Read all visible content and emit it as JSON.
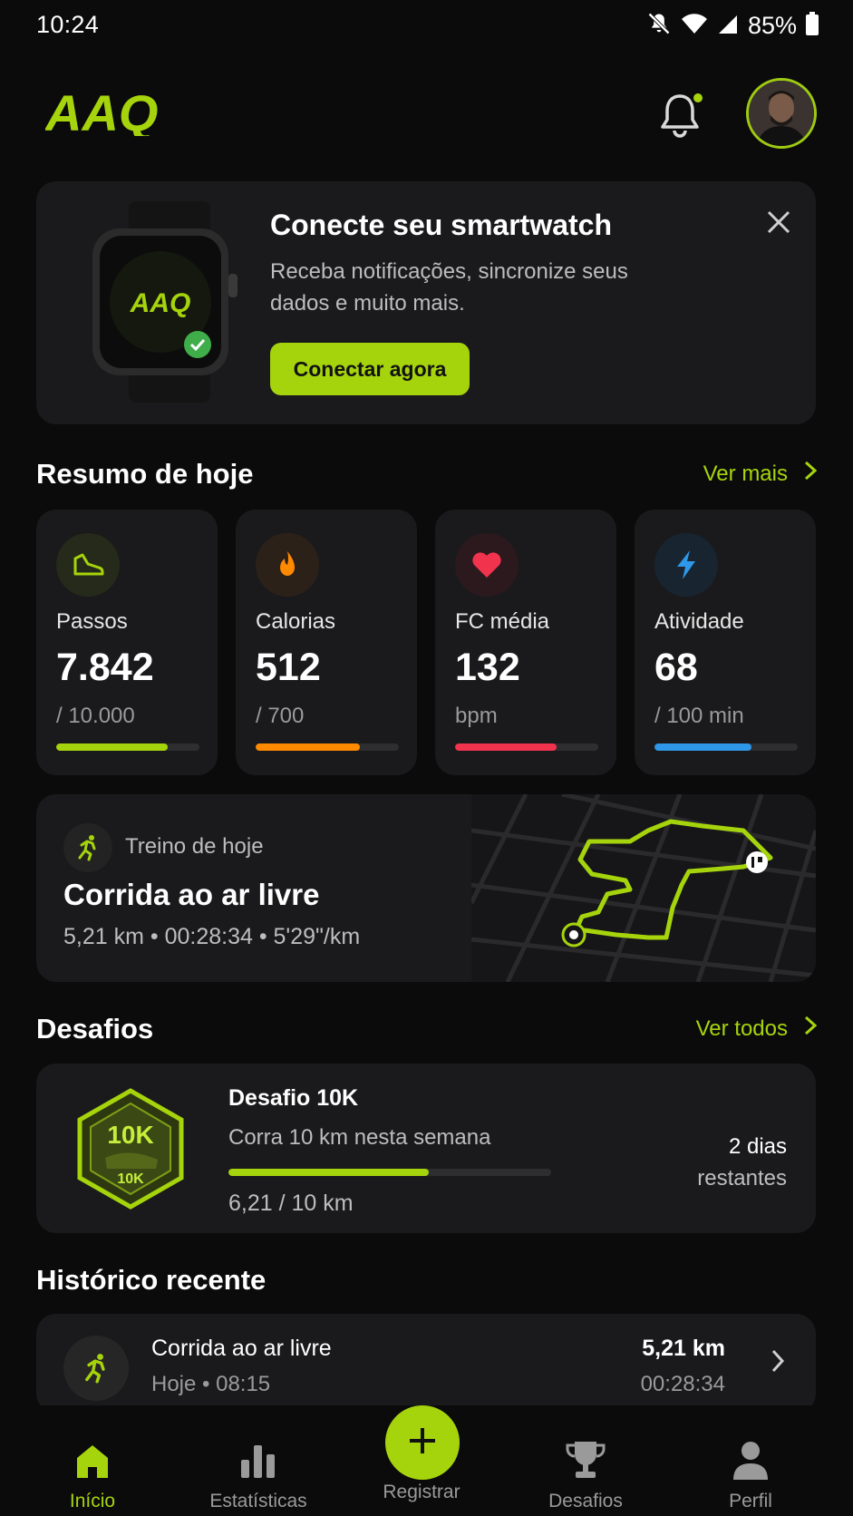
{
  "status_bar": {
    "time": "10:24",
    "battery_pct": "85%"
  },
  "header": {
    "logo_text": "AAQ"
  },
  "smartwatch_card": {
    "title": "Conecte seu smartwatch",
    "description": "Receba notificações, sincronize seus dados e muito mais.",
    "button_label": "Conectar agora",
    "watch_logo": "AAQ"
  },
  "today_summary": {
    "title": "Resumo de hoje",
    "link": "Ver mais",
    "metrics": [
      {
        "label": "Passos",
        "value": "7.842",
        "sub": "/ 10.000",
        "progress": 0.78,
        "color": "#a6d40c",
        "icon": "shoe-icon"
      },
      {
        "label": "Calorias",
        "value": "512",
        "sub": "/ 700",
        "progress": 0.73,
        "color": "#ff8a00",
        "icon": "flame-icon"
      },
      {
        "label": "FC média",
        "value": "132",
        "sub": "bpm",
        "progress": 0.71,
        "color": "#f2334d",
        "icon": "heart-icon"
      },
      {
        "label": "Atividade",
        "value": "68",
        "sub": "/ 100 min",
        "progress": 0.68,
        "color": "#2e97e8",
        "icon": "bolt-icon"
      }
    ]
  },
  "today_workout": {
    "label": "Treino de hoje",
    "title": "Corrida ao ar livre",
    "stats": "5,21 km • 00:28:34 • 5'29\"/km"
  },
  "challenges": {
    "title": "Desafios",
    "link": "Ver todos",
    "item": {
      "badge_top": "10K",
      "badge_bottom": "10K",
      "title": "Desafio 10K",
      "description": "Corra 10 km nesta semana",
      "progress": 0.621,
      "progress_text": "6,21 / 10 km",
      "days": "2 dias",
      "remaining": "restantes"
    }
  },
  "history": {
    "title": "Histórico recente",
    "item": {
      "title": "Corrida ao ar livre",
      "date": "Hoje • 08:15",
      "distance": "5,21 km",
      "duration": "00:28:34"
    }
  },
  "bottom_nav": {
    "items": [
      {
        "label": "Início",
        "icon": "home-icon",
        "active": true
      },
      {
        "label": "Estatísticas",
        "icon": "bar-chart-icon",
        "active": false
      },
      {
        "label": "Registrar",
        "icon": "plus-icon",
        "active": false
      },
      {
        "label": "Desafios",
        "icon": "trophy-icon",
        "active": false
      },
      {
        "label": "Perfil",
        "icon": "person-icon",
        "active": false
      }
    ]
  },
  "colors": {
    "accent": "#a6d40c",
    "background": "#0b0b0c",
    "card": "#1a1a1c"
  }
}
